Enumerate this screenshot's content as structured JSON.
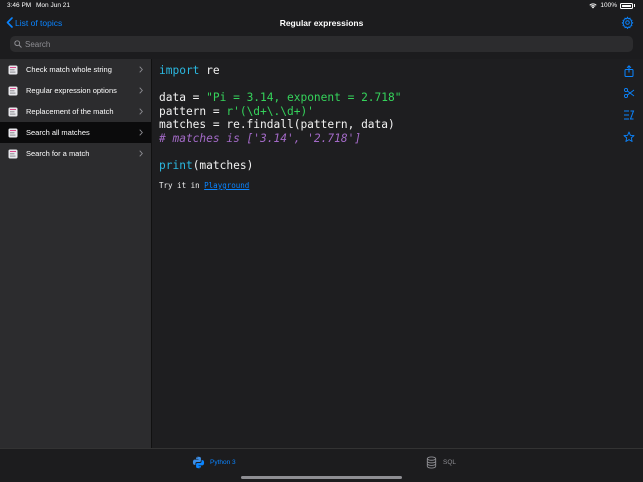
{
  "status": {
    "time": "3:46 PM",
    "date": "Mon Jun 21",
    "battery": "100%"
  },
  "nav": {
    "back_label": "List of topics",
    "title": "Regular expressions"
  },
  "search": {
    "placeholder": "Search"
  },
  "sidebar": {
    "items": [
      {
        "label": "Check match whole string",
        "selected": false
      },
      {
        "label": "Regular expression options",
        "selected": false
      },
      {
        "label": "Replacement of the match",
        "selected": false
      },
      {
        "label": "Search all matches",
        "selected": true
      },
      {
        "label": "Search for a match",
        "selected": false
      }
    ]
  },
  "code": {
    "line1_kw": "import",
    "line1_rest": " re",
    "line2_a": "data = ",
    "line2_str": "\"Pi = 3.14, exponent = 2.718\"",
    "line3_a": "pattern = ",
    "line3_str": "r'(\\d+\\.\\d+)'",
    "line4": "matches = re.findall(pattern, data)",
    "line5_comment": "# matches is ['3.14', '2.718']",
    "line6_kw": "print",
    "line6_rest": "(matches)",
    "try_prefix": "Try it in ",
    "try_link": "Playground"
  },
  "tabs": [
    {
      "label": "Python 3",
      "icon": "python-icon",
      "active": true
    },
    {
      "label": "SQL",
      "icon": "database-icon",
      "active": false
    }
  ],
  "colors": {
    "accent": "#0a84ff",
    "keyword": "#2bb8e0",
    "string": "#35d35b",
    "comment": "#a36ac7"
  }
}
